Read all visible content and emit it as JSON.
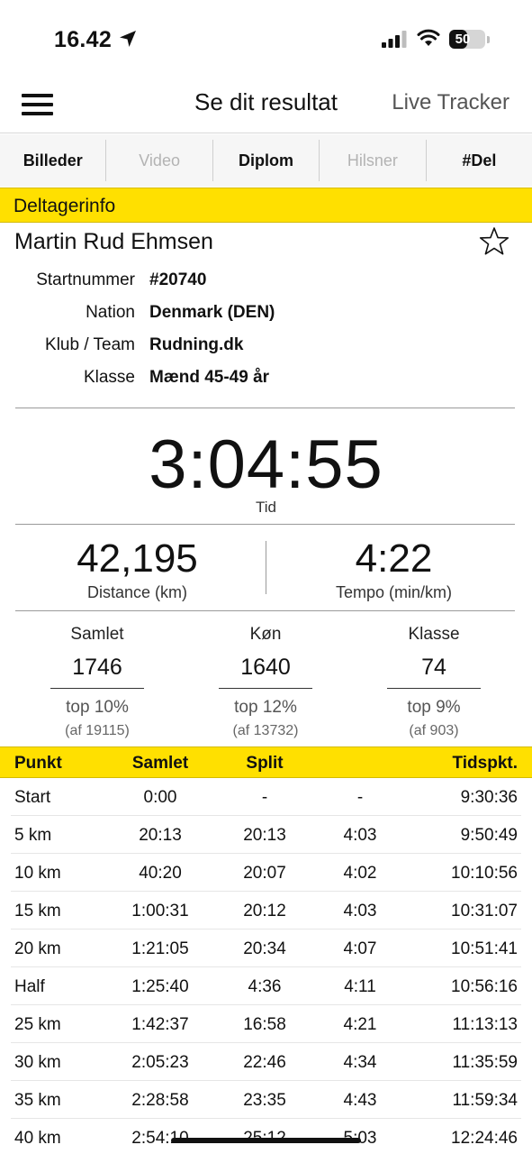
{
  "status_bar": {
    "time": "16.42",
    "battery": "50",
    "battery_level": 0.5
  },
  "nav": {
    "title": "Se dit resultat",
    "live_tracker": "Live Tracker"
  },
  "tabs": [
    {
      "label": "Billeder",
      "enabled": true
    },
    {
      "label": "Video",
      "enabled": false
    },
    {
      "label": "Diplom",
      "enabled": true
    },
    {
      "label": "Hilsner",
      "enabled": false
    },
    {
      "label": "#Del",
      "enabled": true
    }
  ],
  "participant": {
    "section_title": "Deltagerinfo",
    "name": "Martin Rud Ehmsen",
    "rows": [
      {
        "label": "Startnummer",
        "value": "#20740"
      },
      {
        "label": "Nation",
        "value": "Denmark (DEN)"
      },
      {
        "label": "Klub / Team",
        "value": "Rudning.dk"
      },
      {
        "label": "Klasse",
        "value": "Mænd 45-49 år"
      }
    ]
  },
  "result": {
    "time": "3:04:55",
    "time_label": "Tid",
    "distance": "42,195",
    "distance_label": "Distance (km)",
    "pace": "4:22",
    "pace_label": "Tempo (min/km)"
  },
  "rankings": [
    {
      "title": "Samlet",
      "value": "1746",
      "top": "top 10%",
      "of": "(af 19115)"
    },
    {
      "title": "Køn",
      "value": "1640",
      "top": "top 12%",
      "of": "(af 13732)"
    },
    {
      "title": "Klasse",
      "value": "74",
      "top": "top 9%",
      "of": "(af 903)"
    }
  ],
  "splits": {
    "headers": {
      "point": "Punkt",
      "total": "Samlet",
      "split": "Split",
      "pace": "",
      "clock": "Tidspkt."
    },
    "rows": [
      {
        "point": "Start",
        "total": "0:00",
        "split": "-",
        "pace": "-",
        "clock": "9:30:36"
      },
      {
        "point": "5 km",
        "total": "20:13",
        "split": "20:13",
        "pace": "4:03",
        "clock": "9:50:49"
      },
      {
        "point": "10 km",
        "total": "40:20",
        "split": "20:07",
        "pace": "4:02",
        "clock": "10:10:56"
      },
      {
        "point": "15 km",
        "total": "1:00:31",
        "split": "20:12",
        "pace": "4:03",
        "clock": "10:31:07"
      },
      {
        "point": "20 km",
        "total": "1:21:05",
        "split": "20:34",
        "pace": "4:07",
        "clock": "10:51:41"
      },
      {
        "point": "Half",
        "total": "1:25:40",
        "split": "4:36",
        "pace": "4:11",
        "clock": "10:56:16"
      },
      {
        "point": "25 km",
        "total": "1:42:37",
        "split": "16:58",
        "pace": "4:21",
        "clock": "11:13:13"
      },
      {
        "point": "30 km",
        "total": "2:05:23",
        "split": "22:46",
        "pace": "4:34",
        "clock": "11:35:59"
      },
      {
        "point": "35 km",
        "total": "2:28:58",
        "split": "23:35",
        "pace": "4:43",
        "clock": "11:59:34"
      },
      {
        "point": "40 km",
        "total": "2:54:10",
        "split": "25:12",
        "pace": "5:03",
        "clock": "12:24:46"
      }
    ]
  },
  "colors": {
    "accent_yellow": "#ffe000"
  }
}
